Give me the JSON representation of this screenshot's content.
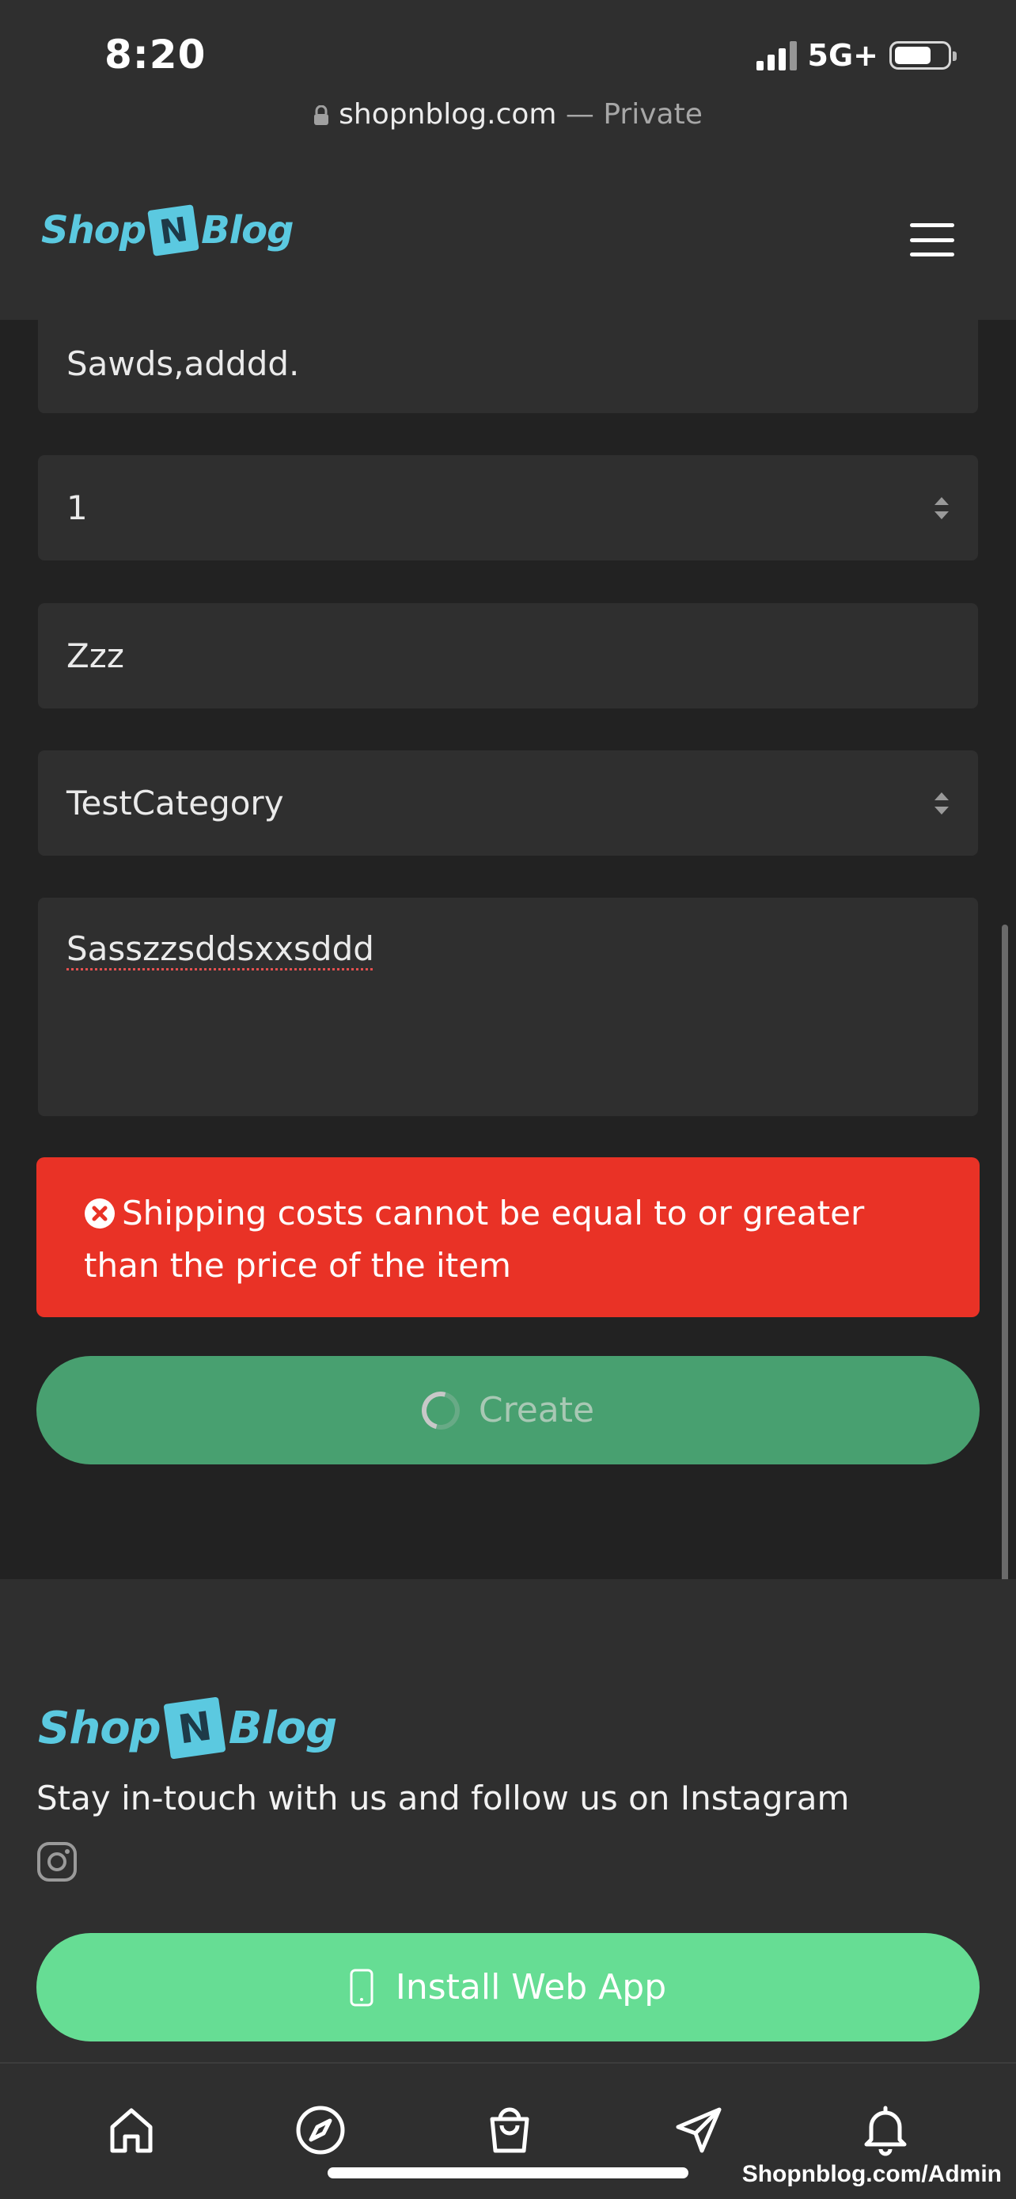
{
  "status_bar": {
    "time": "8:20",
    "network": "5G+",
    "battery_level": 0.7
  },
  "browser": {
    "domain": "shopnblog.com",
    "mode_separator": "—",
    "mode": "Private"
  },
  "header": {
    "logo_left": "Shop",
    "logo_mark": "N",
    "logo_right": "Blog",
    "menu_icon": "hamburger-icon"
  },
  "form": {
    "shipping_address_value": "Sawds,adddd.",
    "quantity_value": "1",
    "title_value": "Zzz",
    "category_value": "TestCategory",
    "description_value": "Sasszzsddsxxsddd"
  },
  "error": {
    "icon": "error-x-icon",
    "message": "Shipping costs cannot be equal to or greater than the price of the item"
  },
  "create_button": {
    "label": "Create",
    "loading": true
  },
  "footer": {
    "logo_left": "Shop",
    "logo_mark": "N",
    "logo_right": "Blog",
    "follow_text": "Stay in-touch with us and follow us on Instagram",
    "instagram_icon": "instagram-icon",
    "install_label": "Install Web App",
    "install_icon": "phone-icon"
  },
  "bottom_nav": [
    {
      "icon": "home-icon"
    },
    {
      "icon": "compass-icon"
    },
    {
      "icon": "shopping-bag-icon"
    },
    {
      "icon": "send-icon"
    },
    {
      "icon": "bell-icon"
    }
  ],
  "watermark": "Shopnblog.com/Admin",
  "colors": {
    "background": "#222222",
    "panel": "#2f2f2f",
    "brand": "#5bc9e0",
    "error": "#e93226",
    "create_button": "#48a070",
    "install_button": "#66dd94"
  }
}
